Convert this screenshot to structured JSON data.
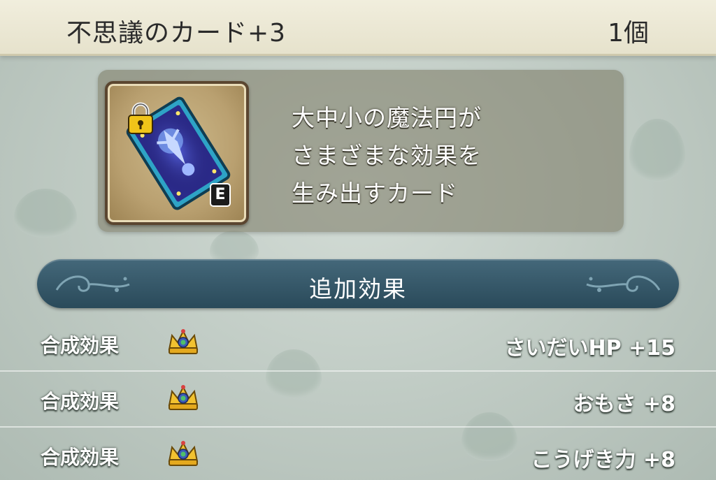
{
  "header": {
    "item_name": "不思議のカード+3",
    "count": "1個"
  },
  "item": {
    "icon": "magic-card-icon",
    "equipped_badge": "E",
    "locked_icon": "padlock-icon",
    "description_lines": [
      "大中小の魔法円が",
      "さまざまな効果を",
      "生み出すカード"
    ]
  },
  "section": {
    "title": "追加効果"
  },
  "effects": [
    {
      "label": "合成効果",
      "icon": "crown-icon",
      "value": "さいだいHP +15"
    },
    {
      "label": "合成効果",
      "icon": "crown-icon",
      "value": "おもさ +8"
    },
    {
      "label": "合成効果",
      "icon": "crown-icon",
      "value": "こうげき力 +8"
    }
  ],
  "colors": {
    "header_bg": "#eeead6",
    "section_bar": "#2f5060",
    "panel_bg": "#7a7860"
  }
}
